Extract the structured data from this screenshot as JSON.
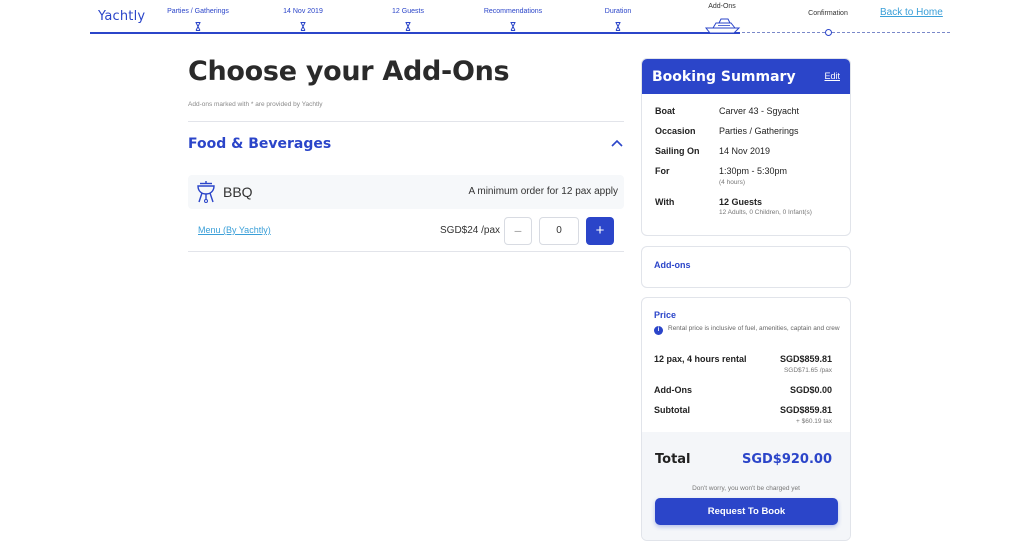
{
  "brand": {
    "logo": "Yachtly",
    "accent": "#2b45c9",
    "link_color": "#3a9fd8"
  },
  "progress": {
    "steps": [
      {
        "label": "Parties / Gatherings",
        "state": "done"
      },
      {
        "label": "14 Nov 2019",
        "state": "done"
      },
      {
        "label": "12 Guests",
        "state": "done"
      },
      {
        "label": "Recommendations",
        "state": "done"
      },
      {
        "label": "Duration",
        "state": "done"
      },
      {
        "label": "Add-Ons",
        "state": "current"
      },
      {
        "label": "Confirmation",
        "state": "upcoming"
      }
    ],
    "back_link": "Back to Home"
  },
  "main": {
    "title": "Choose your Add-Ons",
    "note": "Add-ons marked with * are provided by Yachtly",
    "section": {
      "title": "Food & Beverages",
      "expanded": true,
      "item": {
        "name": "BBQ",
        "icon": "bbq-grill-icon",
        "note": "A minimum order for 12 pax apply",
        "menu_link": "Menu (By Yachtly)",
        "price": "SGD$24 /pax",
        "quantity": "0",
        "minus": "−",
        "plus": "+"
      }
    }
  },
  "summary": {
    "title": "Booking Summary",
    "edit": "Edit",
    "rows": [
      {
        "label": "Boat",
        "value": "Carver 43 - Sgyacht"
      },
      {
        "label": "Occasion",
        "value": "Parties / Gatherings"
      },
      {
        "label": "Sailing On",
        "value": "14 Nov 2019"
      },
      {
        "label": "For",
        "value": "1:30pm - 5:30pm",
        "sub": "(4 hours)"
      },
      {
        "label": "With",
        "value": "12 Guests",
        "sub": "12 Adults, 0 Children, 0 Infant(s)"
      }
    ]
  },
  "addons": {
    "label": "Add-ons"
  },
  "price": {
    "label": "Price",
    "info": "Rental price is inclusive of fuel, amenities, captain and crew",
    "lines": [
      {
        "label": "12 pax, 4 hours rental",
        "value": "SGD$859.81",
        "sub": "SGD$71.65 /pax"
      },
      {
        "label": "Add-Ons",
        "value": "SGD$0.00"
      },
      {
        "label": "Subtotal",
        "value": "SGD$859.81",
        "sub": "+ $60.19 tax"
      }
    ],
    "total_label": "Total",
    "total_value": "SGD$920.00",
    "charge_note": "Don't worry, you won't be charged yet",
    "button": "Request To Book"
  }
}
